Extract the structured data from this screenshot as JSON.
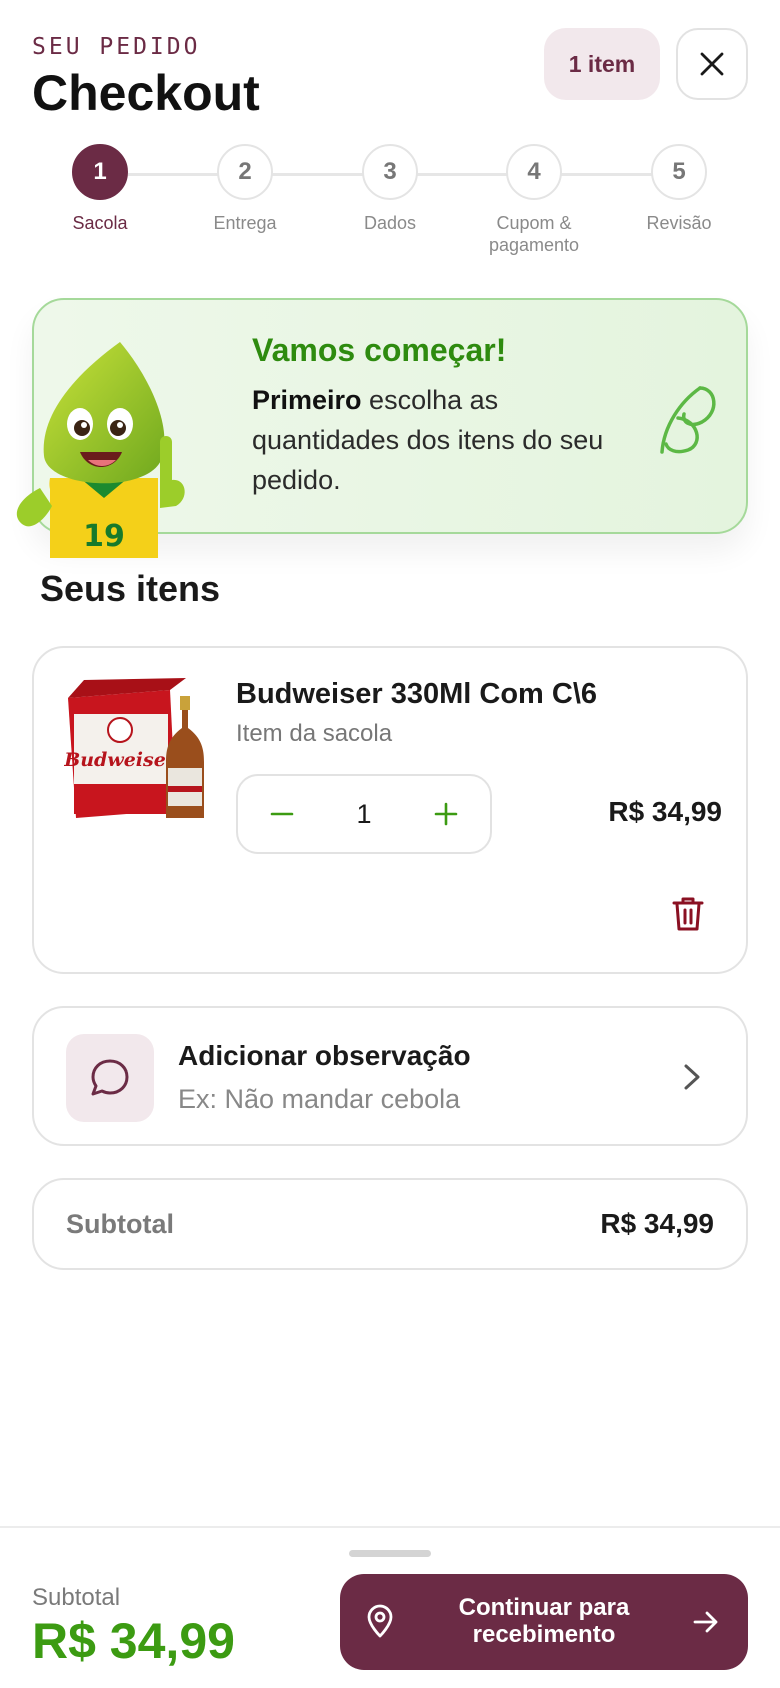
{
  "header": {
    "eyebrow": "SEU PEDIDO",
    "title": "Checkout",
    "item_count": "1 item"
  },
  "stepper": {
    "current_step": 1,
    "steps": [
      {
        "number": "1",
        "label": "Sacola"
      },
      {
        "number": "2",
        "label": "Entrega"
      },
      {
        "number": "3",
        "label": "Dados"
      },
      {
        "number": "4",
        "label": "Cupom & pagamento"
      },
      {
        "number": "5",
        "label": "Revisão"
      }
    ]
  },
  "banner": {
    "title": "Vamos começar!",
    "text_bold": "Primeiro",
    "text_rest": " escolha as quantidades dos itens do seu pedido.",
    "mascot_number": "19"
  },
  "items_section": {
    "title": "Seus itens",
    "items": [
      {
        "name": "Budweiser 330Ml Com C\\6",
        "subtitle": "Item da sacola",
        "quantity": "1",
        "price": "R$ 34,99",
        "image_brand": "Budweiser"
      }
    ]
  },
  "observation": {
    "title": "Adicionar observação",
    "placeholder": "Ex: Não mandar cebola"
  },
  "subtotal": {
    "label": "Subtotal",
    "value": "R$ 34,99"
  },
  "footer": {
    "label": "Subtotal",
    "total": "R$ 34,99",
    "cta_label": "Continuar para recebimento"
  },
  "colors": {
    "brand": "#6b2b45",
    "accent_green": "#3c9b12",
    "banner_green": "#2e8b0f"
  }
}
